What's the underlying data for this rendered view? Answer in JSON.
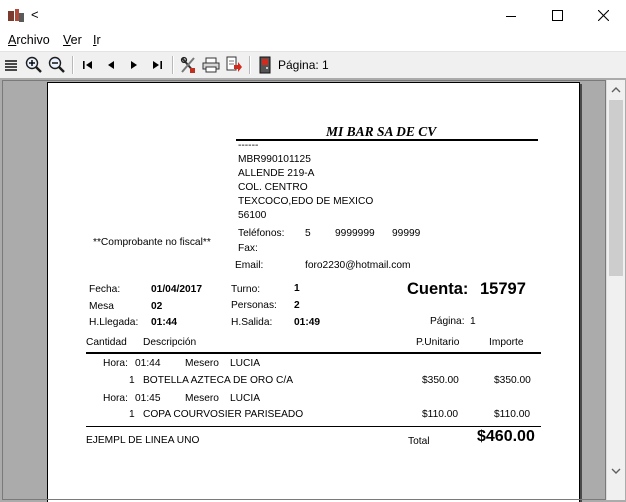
{
  "window": {
    "title": "<"
  },
  "menu": {
    "items": [
      {
        "key": "A",
        "rest": "rchivo"
      },
      {
        "key": "V",
        "rest": "er"
      },
      {
        "key": "I",
        "rest": "r"
      }
    ]
  },
  "toolbar": {
    "page_label": "Página: 1",
    "icons": [
      "layout-icon",
      "zoom-in-icon",
      "zoom-out-icon",
      "first-page-icon",
      "prev-page-icon",
      "next-page-icon",
      "last-page-icon",
      "tools-icon",
      "print-icon",
      "export-icon",
      "exit-icon"
    ]
  },
  "colors": {
    "toolbar": "#f0f0f0",
    "viewport": "#ababab",
    "paper": "#ffffff"
  },
  "receipt": {
    "company": "MI BAR SA DE CV",
    "dashes": "------",
    "rfc": "MBR990101125",
    "address1": "ALLENDE 219-A",
    "address2": "COL. CENTRO",
    "address3": "TEXCOCO,EDO DE MEXICO",
    "zip": "56100",
    "note": "**Comprobante no fiscal**",
    "phones_label": "Teléfonos:",
    "phone1": "5",
    "phone2": "9999999",
    "phone3": "99999",
    "fax_label": "Fax:",
    "email_label": "Email:",
    "email": "foro2230@hotmail.com",
    "fecha_label": "Fecha:",
    "fecha": "01/04/2017",
    "turno_label": "Turno:",
    "turno": "1",
    "mesa_label": "Mesa",
    "mesa": "02",
    "personas_label": "Personas:",
    "personas": "2",
    "llegada_label": "H.Llegada:",
    "llegada": "01:44",
    "salida_label": "H.Salida:",
    "salida": "01:49",
    "cuenta_label": "Cuenta:",
    "cuenta": "15797",
    "pagina_label": "Página:",
    "pagina": "1",
    "col_cantidad": "Cantidad",
    "col_descripcion": "Descripción",
    "col_punitario": "P.Unitario",
    "col_importe": "Importe",
    "orders": [
      {
        "hora_label": "Hora:",
        "hora": "01:44",
        "mesero_label": "Mesero",
        "mesero": "LUCIA",
        "qty": "1",
        "desc": "BOTELLA AZTECA DE ORO C/A",
        "unit": "$350.00",
        "amount": "$350.00"
      },
      {
        "hora_label": "Hora:",
        "hora": "01:45",
        "mesero_label": "Mesero",
        "mesero": "LUCIA",
        "qty": "1",
        "desc": "COPA  COURVOSIER  PARISEADO",
        "unit": "$110.00",
        "amount": "$110.00"
      }
    ],
    "footer_line": "EJEMPL DE LINEA UNO",
    "total_label": "Total",
    "total": "$460.00"
  }
}
